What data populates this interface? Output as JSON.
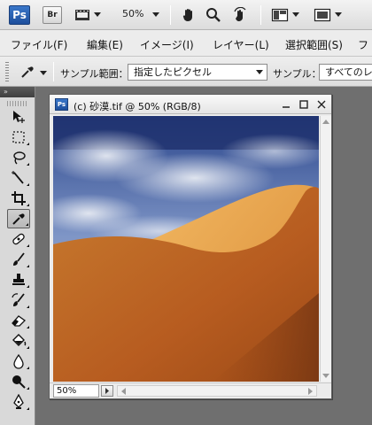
{
  "app": {
    "logo": "Ps",
    "bridge_label": "Br",
    "zoom_level": "50%"
  },
  "menu": {
    "items": [
      "ファイル(F)",
      "編集(E)",
      "イメージ(I)",
      "レイヤー(L)",
      "選択範囲(S)",
      "フ"
    ]
  },
  "options": {
    "sample_range_label": "サンプル範囲：",
    "sample_range_value": "指定したピクセル",
    "sample_label": "サンプル：",
    "sample_value": "すべてのレ"
  },
  "toolbox": {
    "header": "»",
    "tools": [
      "move-tool",
      "marquee-tool",
      "lasso-tool",
      "magic-wand-tool",
      "crop-tool",
      "eyedropper-tool",
      "healing-brush-tool",
      "brush-tool",
      "clone-stamp-tool",
      "history-brush-tool",
      "eraser-tool",
      "paint-bucket-tool",
      "blur-tool",
      "dodge-tool",
      "pen-tool"
    ],
    "active_tool": "eyedropper-tool"
  },
  "document": {
    "title": "(c) 砂漠.tif @ 50% (RGB/8)",
    "zoom": "50%",
    "image_subject": "desert sand dune under cloudy blue sky"
  },
  "colors": {
    "accent_ps": "#2a5fae",
    "sky_top": "#1f3a7a",
    "sand_light": "#e8a84a",
    "sand_dark": "#b0511c"
  }
}
